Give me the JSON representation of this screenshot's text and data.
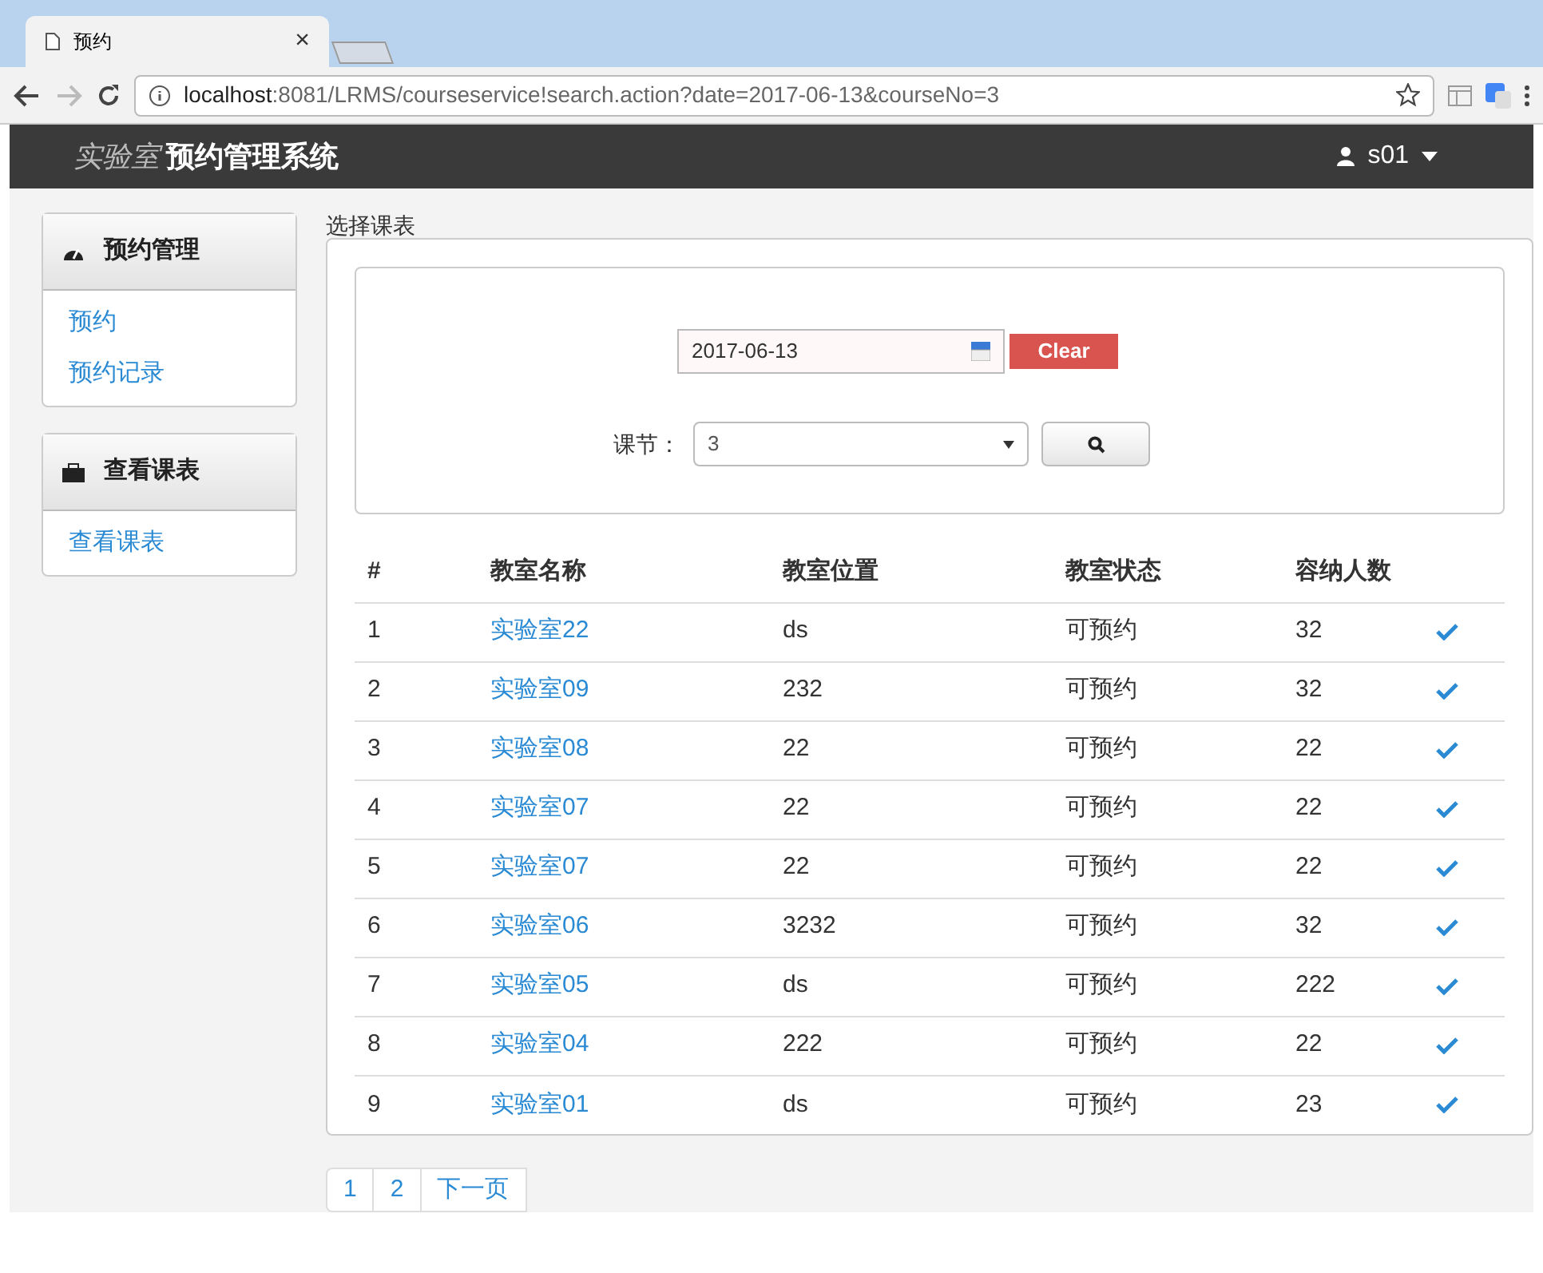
{
  "browser": {
    "tab_title": "预约",
    "tab_close": "×",
    "url_host": "localhost",
    "url_rest": ":8081/LRMS/courseservice!search.action?date=2017-06-13&courseNo=3"
  },
  "navbar": {
    "brand_italic": "实验室",
    "brand": "预约管理系统",
    "user": "s01"
  },
  "sidebar": [
    {
      "kind": "gauge",
      "title": "预约管理",
      "items": [
        "预约",
        "预约记录"
      ]
    },
    {
      "kind": "briefcase",
      "title": "查看课表",
      "items": [
        "查看课表"
      ]
    }
  ],
  "panel_title": "选择课表",
  "form": {
    "date": "2017-06-13",
    "clear": "Clear",
    "course_label": "课节：",
    "course_value": "3"
  },
  "table": {
    "columns": [
      "#",
      "教室名称",
      "教室位置",
      "教室状态",
      "容纳人数"
    ],
    "rows": [
      {
        "no": "1",
        "name": "实验室22",
        "location": "ds",
        "status": "可预约",
        "capacity": "32"
      },
      {
        "no": "2",
        "name": "实验室09",
        "location": "232",
        "status": "可预约",
        "capacity": "32"
      },
      {
        "no": "3",
        "name": "实验室08",
        "location": "22",
        "status": "可预约",
        "capacity": "22"
      },
      {
        "no": "4",
        "name": "实验室07",
        "location": "22",
        "status": "可预约",
        "capacity": "22"
      },
      {
        "no": "5",
        "name": "实验室07",
        "location": "22",
        "status": "可预约",
        "capacity": "22"
      },
      {
        "no": "6",
        "name": "实验室06",
        "location": "3232",
        "status": "可预约",
        "capacity": "32"
      },
      {
        "no": "7",
        "name": "实验室05",
        "location": "ds",
        "status": "可预约",
        "capacity": "222"
      },
      {
        "no": "8",
        "name": "实验室04",
        "location": "222",
        "status": "可预约",
        "capacity": "22"
      },
      {
        "no": "9",
        "name": "实验室01",
        "location": "ds",
        "status": "可预约",
        "capacity": "23"
      }
    ]
  },
  "pagination": [
    "1",
    "2",
    "下一页"
  ]
}
